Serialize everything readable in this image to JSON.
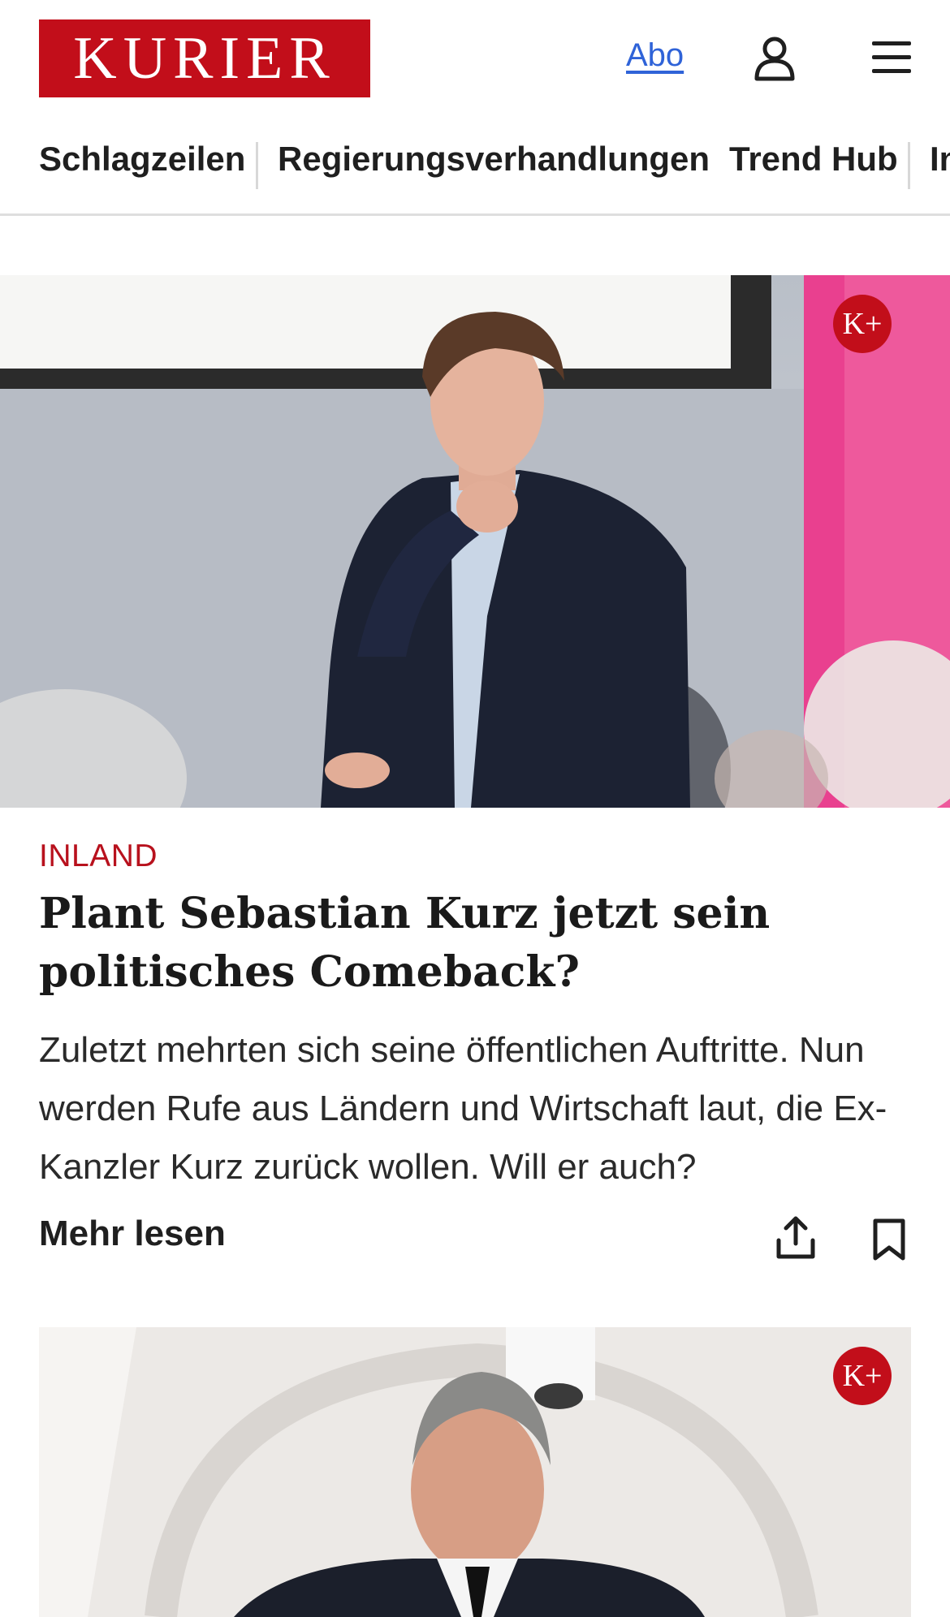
{
  "header": {
    "logo_text": "KURIER",
    "abo_label": "Abo",
    "user_icon": "user-icon",
    "menu_icon": "menu-icon"
  },
  "nav": {
    "items": [
      "Schlagzeilen",
      "Regierungsverhandlungen",
      "Trend Hub",
      "In"
    ]
  },
  "articles": [
    {
      "badge": "K+",
      "kicker": "INLAND",
      "headline": "Plant Sebastian Kurz jetzt sein politisches Comeback?",
      "teaser": "Zuletzt mehrten sich seine öffentlichen Auftritte. Nun werden Rufe aus Ländern und Wirtschaft laut, die Ex-Kanzler Kurz zurück wollen. Will er auch?",
      "more_label": "Mehr lesen",
      "share_icon": "share-icon",
      "bookmark_icon": "bookmark-icon"
    },
    {
      "badge": "K+"
    }
  ],
  "colors": {
    "brand_red": "#c20e1a",
    "kicker_red": "#b8111d",
    "link_blue": "#2f63d8"
  }
}
